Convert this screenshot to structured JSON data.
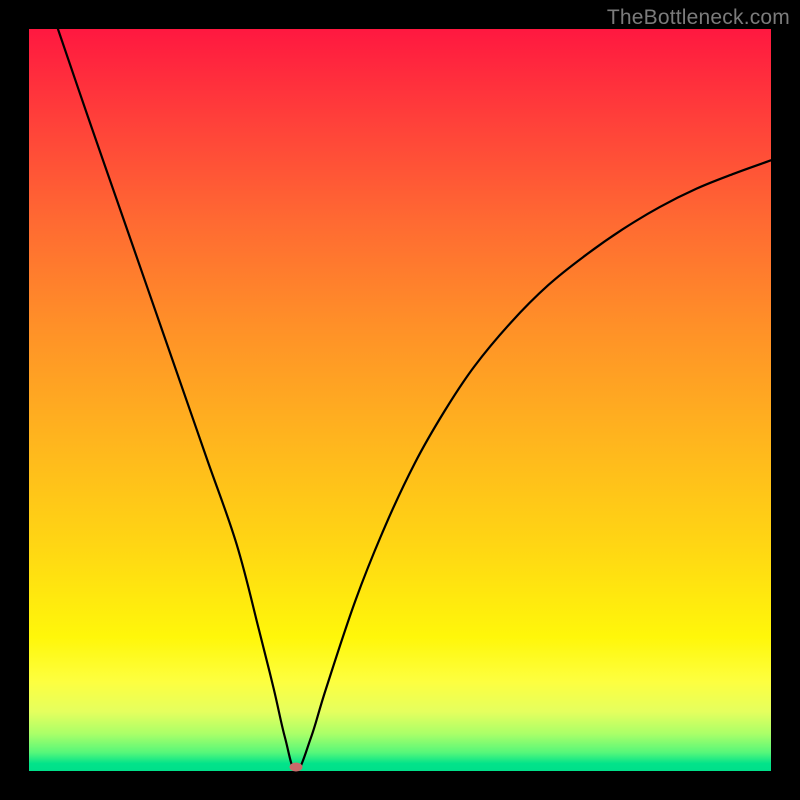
{
  "watermark": "TheBottleneck.com",
  "colors": {
    "frame_bg_top": "#ff1840",
    "frame_bg_bottom": "#00e08a",
    "curve": "#000000",
    "marker": "#c96a6a",
    "page_bg": "#000000"
  },
  "chart_data": {
    "type": "line",
    "title": "",
    "xlabel": "",
    "ylabel": "",
    "xlim": [
      0,
      100
    ],
    "ylim": [
      0,
      100
    ],
    "grid": false,
    "legend": false,
    "series": [
      {
        "name": "bottleneck-curve",
        "x": [
          3.9,
          8,
          12,
          16,
          20,
          24,
          28,
          31,
          33,
          34.5,
          36,
          38,
          40,
          44,
          48,
          52,
          56,
          60,
          65,
          70,
          75,
          80,
          85,
          90,
          95,
          100
        ],
        "y": [
          100,
          88,
          76.5,
          65,
          53.5,
          42,
          30.5,
          19,
          11,
          4.5,
          0,
          4.5,
          11,
          23,
          33,
          41.5,
          48.5,
          54.5,
          60.5,
          65.5,
          69.5,
          73,
          76,
          78.5,
          80.5,
          82.3
        ]
      }
    ],
    "annotations": [
      {
        "type": "marker",
        "x": 36,
        "y": 0.5,
        "shape": "ellipse",
        "color": "#c96a6a"
      }
    ]
  }
}
